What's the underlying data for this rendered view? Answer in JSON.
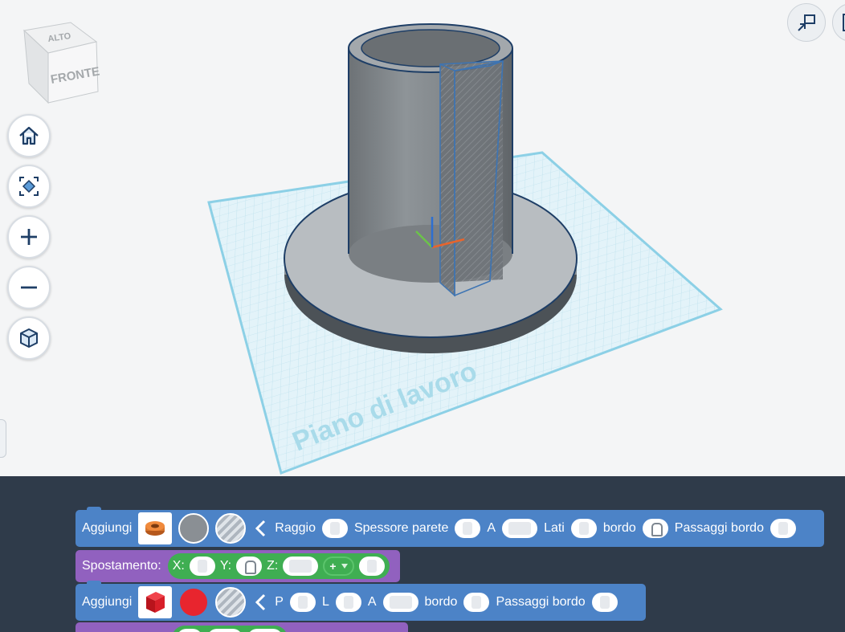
{
  "viewcube": {
    "top_label": "ALTO",
    "front_label": "FRONTE"
  },
  "workplane_label": "Piano di lavoro",
  "nav_buttons": [
    {
      "name": "home-view-button",
      "icon": "home-icon"
    },
    {
      "name": "fit-view-button",
      "icon": "fit-all-icon"
    },
    {
      "name": "zoom-in-button",
      "icon": "plus-icon"
    },
    {
      "name": "zoom-out-button",
      "icon": "minus-icon"
    },
    {
      "name": "projection-button",
      "icon": "cube-icon"
    }
  ],
  "blocks": {
    "tube": {
      "label": "Aggiungi",
      "color_swatch": "#8a8f94",
      "params": [
        "Raggio",
        "Spessore parete",
        "A",
        "Lati",
        "bordo",
        "Passaggi bordo"
      ]
    },
    "move1": {
      "label": "Spostamento:",
      "x": "X:",
      "y": "Y:",
      "z": "Z:",
      "op": "+"
    },
    "box": {
      "label": "Aggiungi",
      "color_swatch": "#e8252e",
      "params": [
        "P",
        "L",
        "A",
        "bordo",
        "Passaggi bordo"
      ]
    }
  },
  "colors": {
    "code_bg": "#2f3b4a",
    "block_blue": "#4c83c7",
    "block_purple": "#9161bf",
    "block_green": "#3fae52"
  }
}
